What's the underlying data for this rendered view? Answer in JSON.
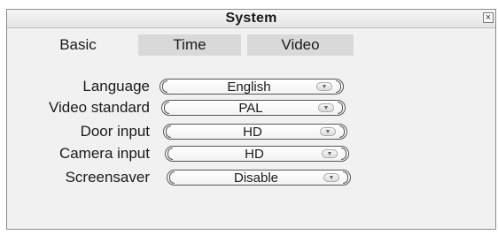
{
  "window": {
    "title": "System",
    "close_glyph": "×"
  },
  "tabs": [
    {
      "label": "Basic",
      "active": true
    },
    {
      "label": "Time",
      "active": false
    },
    {
      "label": "Video",
      "active": false
    }
  ],
  "settings": [
    {
      "label": "Language",
      "value": "English"
    },
    {
      "label": "Video standard",
      "value": "PAL"
    },
    {
      "label": "Door input",
      "value": "HD"
    },
    {
      "label": "Camera input",
      "value": "HD"
    },
    {
      "label": "Screensaver",
      "value": "Disable"
    }
  ],
  "icons": {
    "dropdown": "chevron-down-icon",
    "close": "close-icon"
  },
  "colors": {
    "window_bg": "#f1f1f1",
    "tab_inactive": "#d9d9d9"
  }
}
